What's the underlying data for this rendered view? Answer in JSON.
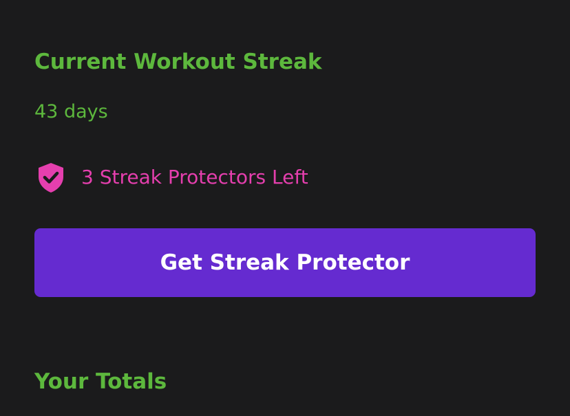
{
  "streak": {
    "title": "Current Workout Streak",
    "value": "43 days"
  },
  "protectors": {
    "icon": "shield-check-icon",
    "label": "3 Streak Protectors Left"
  },
  "actions": {
    "get_protector_label": "Get Streak Protector"
  },
  "totals": {
    "title": "Your Totals"
  },
  "colors": {
    "background": "#1b1b1c",
    "accent_green": "#5db83d",
    "accent_pink": "#e53fae",
    "button_purple": "#652bd0",
    "button_text": "#ffffff"
  }
}
